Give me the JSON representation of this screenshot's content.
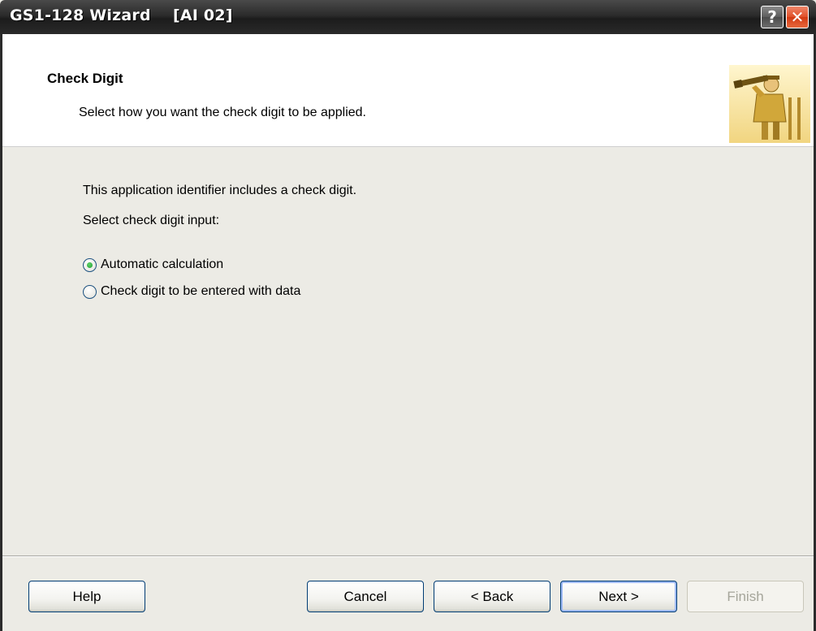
{
  "window": {
    "title": "GS1-128 Wizard    [AI 02]",
    "help_button": "?",
    "close_button": "✕"
  },
  "header": {
    "title": "Check Digit",
    "subtitle": "Select how you want the check digit to be applied."
  },
  "content": {
    "intro": "This application identifier includes a check digit.",
    "select_label": "Select check digit input:",
    "options": [
      {
        "label": "Automatic calculation",
        "selected": true
      },
      {
        "label": "Check digit to be entered with data",
        "selected": false
      }
    ]
  },
  "footer": {
    "help": "Help",
    "cancel": "Cancel",
    "back": "< Back",
    "next": "Next >",
    "finish": "Finish"
  }
}
